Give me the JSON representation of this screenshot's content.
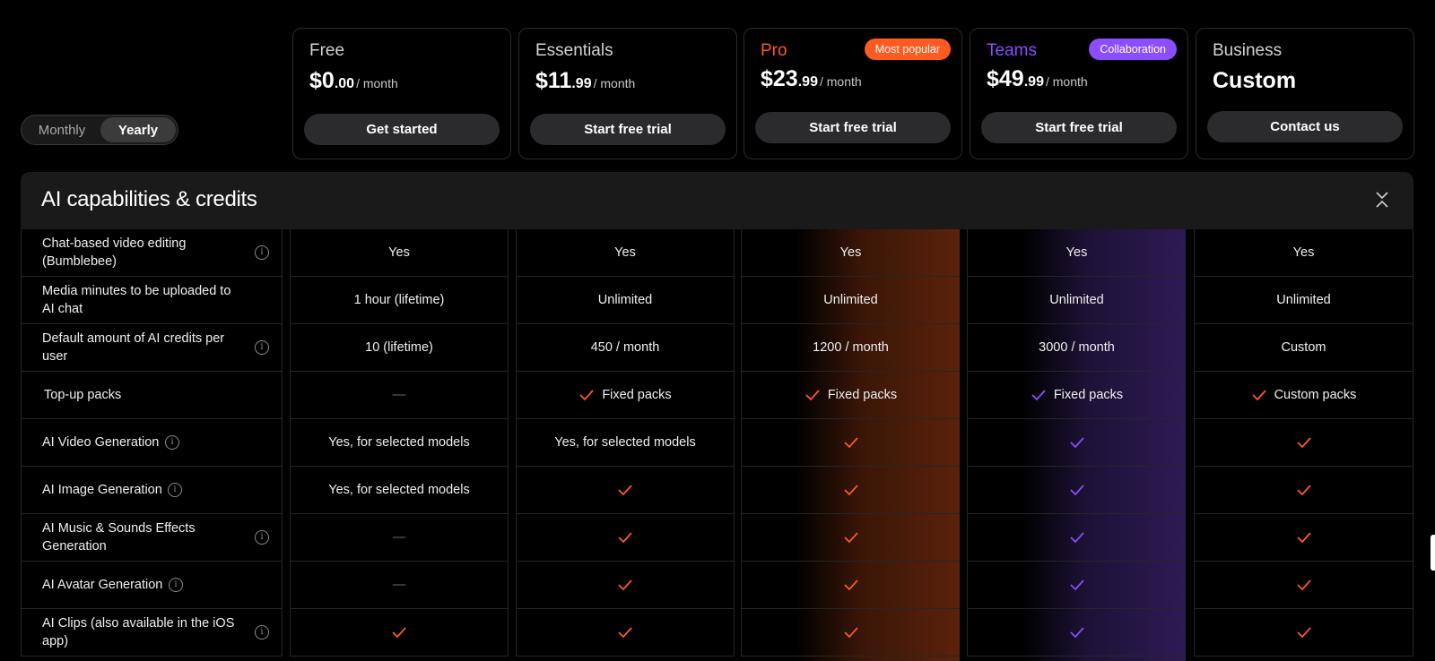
{
  "billing_toggle": {
    "monthly": "Monthly",
    "yearly": "Yearly",
    "selected": "Yearly"
  },
  "plans": [
    {
      "name": "Free",
      "price_main": "$0",
      "price_cents": ".00",
      "per": "/ month",
      "cta": "Get started"
    },
    {
      "name": "Essentials",
      "price_main": "$11",
      "price_cents": ".99",
      "per": "/ month",
      "cta": "Start free trial"
    },
    {
      "name": "Pro",
      "badge": "Most popular",
      "price_main": "$23",
      "price_cents": ".99",
      "per": "/ month",
      "cta": "Start free trial",
      "accent": "#ff5a1f"
    },
    {
      "name": "Teams",
      "badge": "Collaboration",
      "price_main": "$49",
      "price_cents": ".99",
      "per": "/ month",
      "cta": "Start free trial",
      "accent": "#8b4dff"
    },
    {
      "name": "Business",
      "price_text": "Custom",
      "cta": "Contact us"
    }
  ],
  "section": {
    "title": "AI capabilities & credits"
  },
  "colors": {
    "orange": "#ff5a1f",
    "purple": "#8b4dff"
  },
  "rows": [
    {
      "feature": "Chat-based video editing (Bumblebee)",
      "info": true,
      "cells": [
        "Yes",
        "Yes",
        "Yes",
        "Yes",
        "Yes"
      ]
    },
    {
      "feature": "Media minutes to be uploaded to AI chat",
      "info": false,
      "cells": [
        "1 hour (lifetime)",
        "Unlimited",
        "Unlimited",
        "Unlimited",
        "Unlimited"
      ]
    },
    {
      "feature": "Default amount of AI credits per user",
      "info": true,
      "cells": [
        "10 (lifetime)",
        "450  / month",
        "1200  / month",
        "3000  / month",
        "Custom"
      ]
    },
    {
      "feature": "Top-up packs",
      "info": false,
      "cells": [
        "—",
        "✓ Fixed packs",
        "✓ Fixed packs",
        "✓ Fixed packs",
        "✓ Custom packs"
      ]
    },
    {
      "feature": "AI Video Generation",
      "info": true,
      "cells": [
        "Yes, for selected models",
        "Yes, for selected models",
        "✓",
        "✓",
        "✓"
      ]
    },
    {
      "feature": "AI Image Generation",
      "info": true,
      "cells": [
        "Yes, for selected models",
        "✓",
        "✓",
        "✓",
        "✓"
      ]
    },
    {
      "feature": "AI Music & Sounds Effects Generation",
      "info": true,
      "cells": [
        "—",
        "✓",
        "✓",
        "✓",
        "✓"
      ]
    },
    {
      "feature": "AI Avatar Generation",
      "info": true,
      "cells": [
        "—",
        "✓",
        "✓",
        "✓",
        "✓"
      ]
    },
    {
      "feature": "AI Clips (also available in the iOS app)",
      "info": true,
      "cells": [
        "✓",
        "✓",
        "✓",
        "✓",
        "✓"
      ]
    }
  ]
}
